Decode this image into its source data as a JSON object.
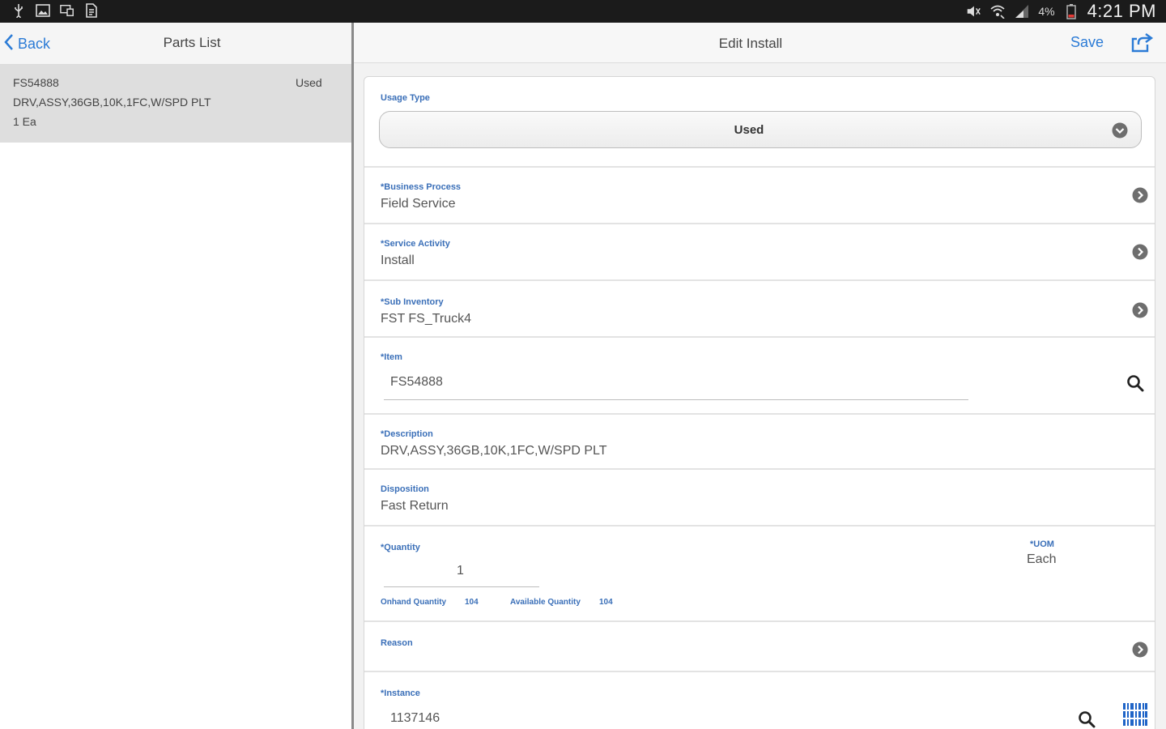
{
  "status_bar": {
    "battery": "4%",
    "time": "4:21 PM",
    "icons": [
      "usb-icon",
      "image-icon",
      "screen-mirror-icon",
      "doc-icon",
      "mute-icon",
      "wifi-icon",
      "signal-icon",
      "battery-icon"
    ]
  },
  "left": {
    "back_label": "Back",
    "title": "Parts List",
    "item": {
      "part_number": "FS54888",
      "status": "Used",
      "description": "DRV,ASSY,36GB,10K,1FC,W/SPD PLT",
      "quantity": "1 Ea"
    }
  },
  "right": {
    "title": "Edit Install",
    "save_label": "Save"
  },
  "form": {
    "usage_type": {
      "label": "Usage Type",
      "value": "Used"
    },
    "business_process": {
      "label": "*Business Process",
      "value": "Field Service"
    },
    "service_activity": {
      "label": "*Service Activity",
      "value": "Install"
    },
    "sub_inventory": {
      "label": "*Sub Inventory",
      "value": "FST FS_Truck4"
    },
    "item": {
      "label": "*Item",
      "value": "FS54888"
    },
    "description": {
      "label": "*Description",
      "value": "DRV,ASSY,36GB,10K,1FC,W/SPD PLT"
    },
    "disposition": {
      "label": "Disposition",
      "value": "Fast Return"
    },
    "quantity": {
      "label": "*Quantity",
      "value": "1",
      "uom_label": "*UOM",
      "uom_value": "Each",
      "onhand_label": "Onhand Quantity",
      "onhand_value": "104",
      "available_label": "Available Quantity",
      "available_value": "104"
    },
    "reason": {
      "label": "Reason",
      "value": ""
    },
    "instance": {
      "label": "*Instance",
      "value": "1137146"
    }
  },
  "colors": {
    "accent": "#2b7bd6",
    "label_blue": "#3a6fb8",
    "status_bar": "#1b1b1b",
    "selected_row": "#dedede"
  }
}
